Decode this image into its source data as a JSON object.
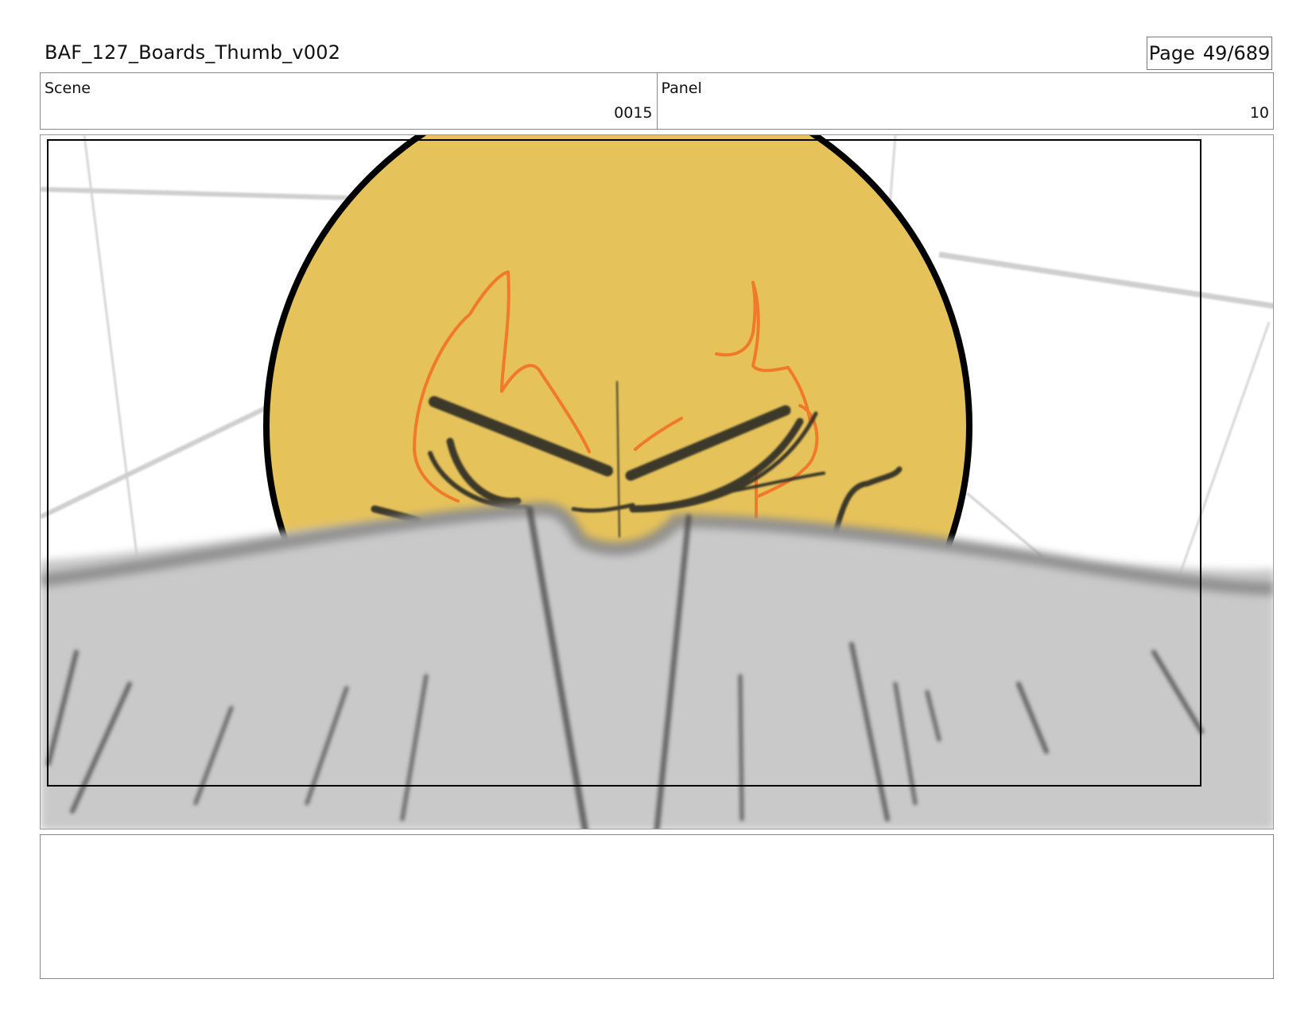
{
  "header": {
    "title": "BAF_127_Boards_Thumb_v002",
    "page_label": "Page",
    "page_value": "49/689"
  },
  "info": {
    "scene_label": "Scene",
    "scene_value": "0015",
    "panel_label": "Panel",
    "panel_value": "10"
  },
  "colors": {
    "sun_fill": "#e6c25a",
    "flame": "#f07a2a",
    "foreground_gray": "#c9c9c9",
    "stroke_dark": "#333333"
  },
  "notes": ""
}
